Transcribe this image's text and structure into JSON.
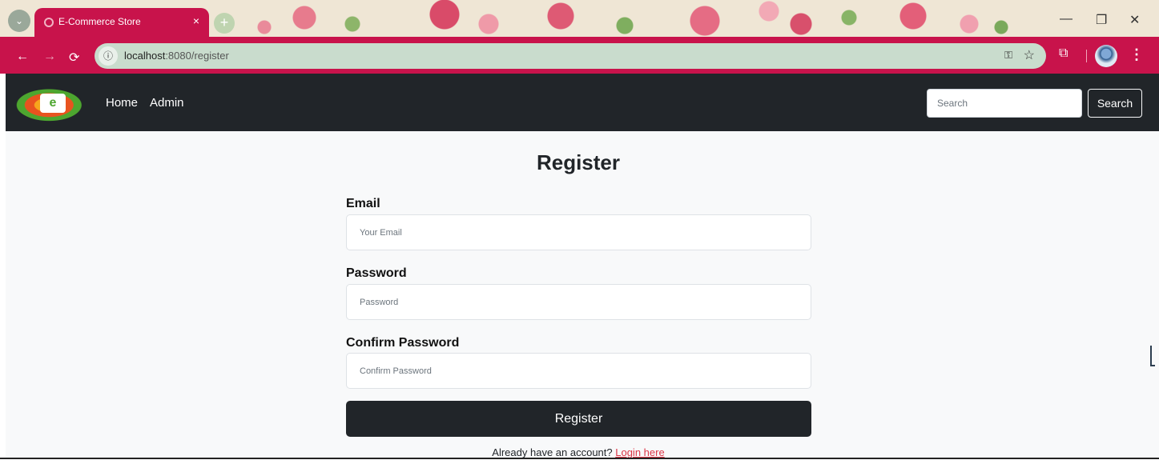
{
  "browser": {
    "tab_title": "E-Commerce Store",
    "tab_close": "×",
    "new_tab": "+",
    "tab_group": "⌄",
    "url_host": "localhost",
    "url_path": ":8080/register",
    "window_controls": {
      "minimize": "—",
      "restore": "❐",
      "close": "✕"
    },
    "nav": {
      "back": "←",
      "forward": "→",
      "reload": "⟳"
    },
    "icons": {
      "info": "ⓘ",
      "key": "⚿",
      "star": "☆",
      "extensions": "⧉",
      "menu": "⋮"
    }
  },
  "navbar": {
    "logo_text": "e",
    "links": [
      {
        "label": "Home"
      },
      {
        "label": "Admin"
      }
    ],
    "search_placeholder": "Search",
    "search_button": "Search"
  },
  "form": {
    "title": "Register",
    "email_label": "Email",
    "email_placeholder": "Your Email",
    "password_label": "Password",
    "password_placeholder": "Password",
    "confirm_label": "Confirm Password",
    "confirm_placeholder": "Confirm Password",
    "submit_label": "Register",
    "login_prompt": "Already have an account? ",
    "login_link": "Login here"
  },
  "colors": {
    "theme_band": "#c8134b",
    "navbar_bg": "#212529",
    "page_bg": "#f8f9fa",
    "link_red": "#dc3545"
  }
}
